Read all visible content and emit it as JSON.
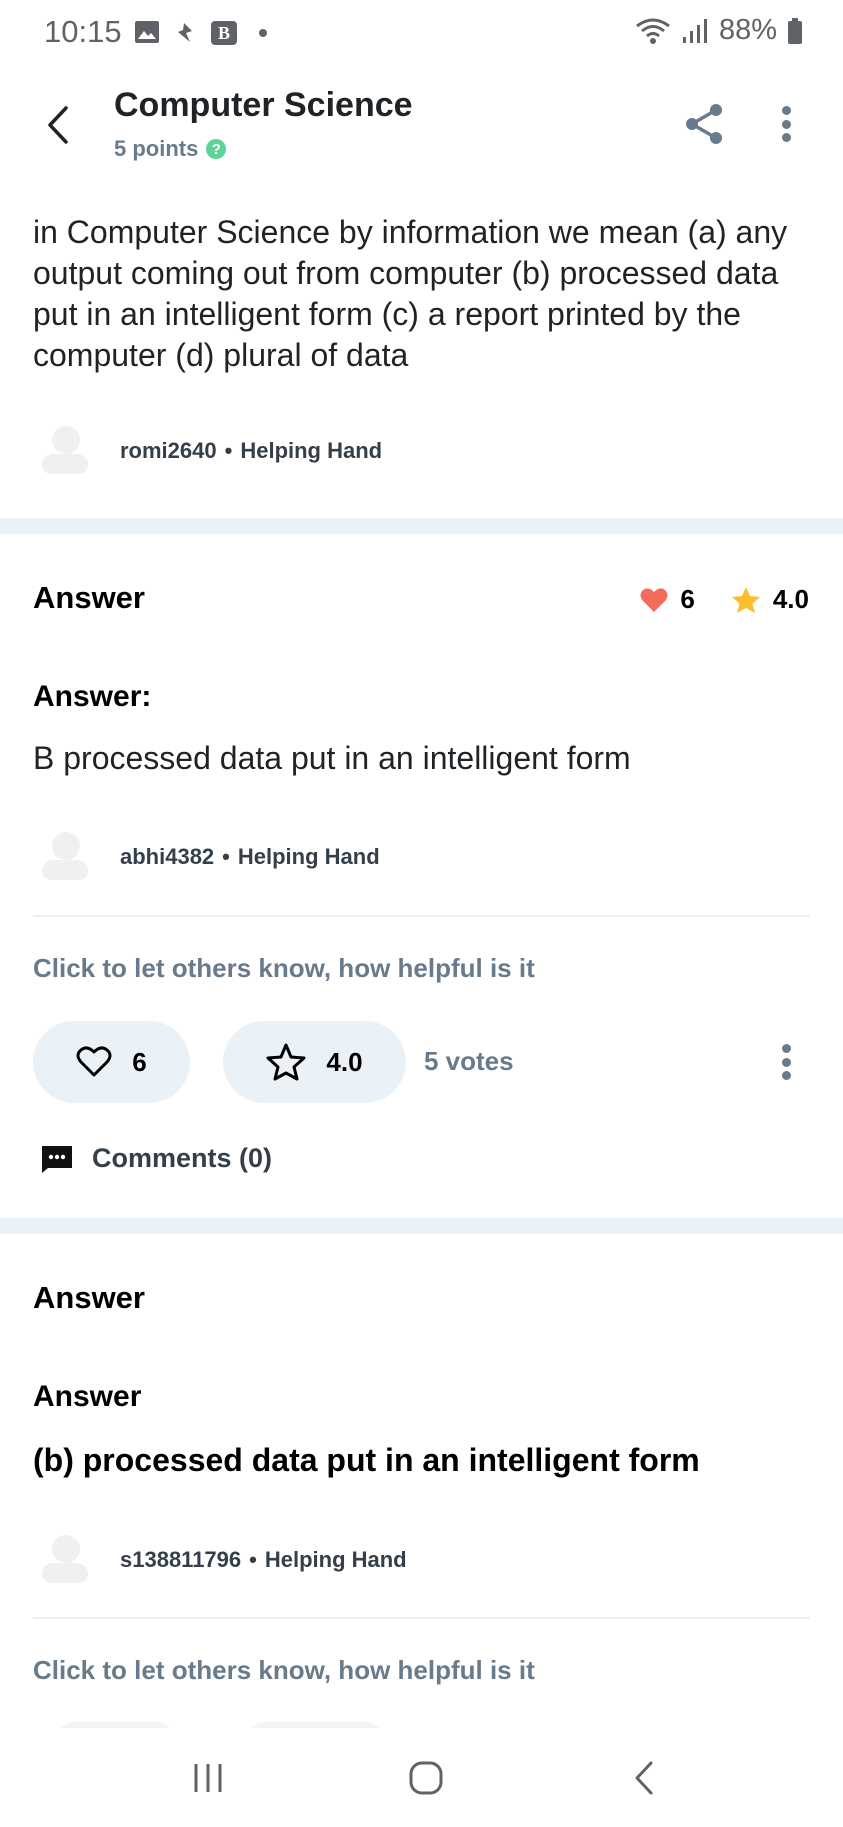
{
  "status_bar": {
    "time": "10:15",
    "battery": "88%"
  },
  "header": {
    "title": "Computer Science",
    "points": "5 points",
    "points_help": "?"
  },
  "question": {
    "text": "in Computer Science by information we mean (a) any output coming out from computer (b) processed data put in an intelligent form (c) a report printed by the computer (d) plural of data",
    "author": "romi2640",
    "author_rank": "Helping Hand"
  },
  "answers": [
    {
      "heading": "Answer",
      "likes": "6",
      "rating": "4.0",
      "sub_heading": "Answer:",
      "body": "B processed data put in an intelligent form",
      "author": "abhi4382",
      "author_rank": "Helping Hand",
      "helpful_prompt": "Click to let others know, how helpful is it",
      "like_count": "6",
      "rating_value": "4.0",
      "votes": "5 votes",
      "comments": "Comments (0)"
    },
    {
      "heading": "Answer",
      "sub_heading": "Answer",
      "body": "(b) processed data put in an intelligent form",
      "author": "s138811796",
      "author_rank": "Helping Hand",
      "helpful_prompt": "Click to let others know, how helpful is it"
    }
  ],
  "separator": "•",
  "colors": {
    "heart": "#f26b5b",
    "star": "#fbbe2e",
    "muted": "#687b8c",
    "section_gap": "#ebf2f7",
    "pill": "#ebf2f7",
    "badge": "#60d399"
  },
  "icons": [
    "gallery-icon",
    "notification-icon",
    "brainly-icon",
    "wifi-icon",
    "signal-icon",
    "battery-icon",
    "back-arrow-icon",
    "share-icon",
    "more-vertical-icon",
    "heart-icon",
    "star-icon",
    "comment-icon",
    "recents-icon",
    "home-icon",
    "nav-back-icon"
  ]
}
